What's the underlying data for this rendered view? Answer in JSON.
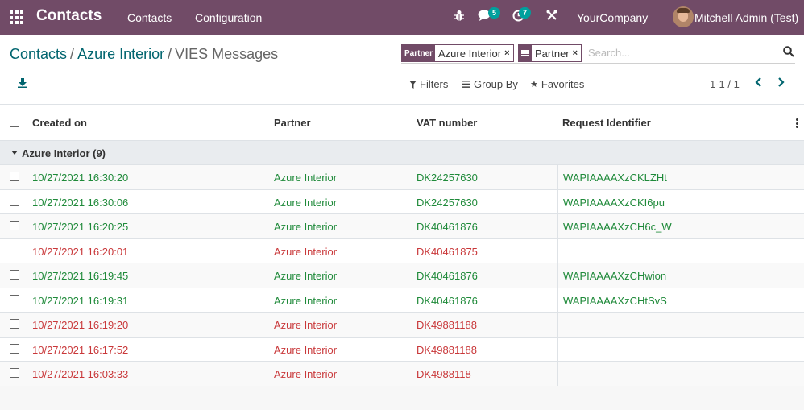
{
  "navbar": {
    "app_title": "Contacts",
    "menu": [
      "Contacts",
      "Configuration"
    ],
    "messages_count": "5",
    "activities_count": "7",
    "company": "YourCompany",
    "user": "Mitchell Admin (Test)"
  },
  "breadcrumb": {
    "items": [
      "Contacts",
      "Azure Interior"
    ],
    "current": "VIES Messages"
  },
  "search": {
    "facets": [
      {
        "head": "Partner",
        "value": "Azure Interior"
      },
      {
        "head_icon": "group-by-icon",
        "value": "Partner"
      }
    ],
    "placeholder": "Search..."
  },
  "toolbar": {
    "filters_label": "Filters",
    "group_by_label": "Group By",
    "favorites_label": "Favorites",
    "pager": "1-1 / 1"
  },
  "table": {
    "columns": [
      "Created on",
      "Partner",
      "VAT number",
      "Request Identifier"
    ],
    "group": {
      "label": "Azure Interior (9)"
    },
    "rows": [
      {
        "created": "10/27/2021 16:30:20",
        "partner": "Azure Interior",
        "vat": "DK24257630",
        "request": "WAPIAAAAXzCKLZHt",
        "status": "ok"
      },
      {
        "created": "10/27/2021 16:30:06",
        "partner": "Azure Interior",
        "vat": "DK24257630",
        "request": "WAPIAAAAXzCKI6pu",
        "status": "ok"
      },
      {
        "created": "10/27/2021 16:20:25",
        "partner": "Azure Interior",
        "vat": "DK40461876",
        "request": "WAPIAAAAXzCH6c_W",
        "status": "ok"
      },
      {
        "created": "10/27/2021 16:20:01",
        "partner": "Azure Interior",
        "vat": "DK40461875",
        "request": "",
        "status": "err"
      },
      {
        "created": "10/27/2021 16:19:45",
        "partner": "Azure Interior",
        "vat": "DK40461876",
        "request": "WAPIAAAAXzCHwion",
        "status": "ok"
      },
      {
        "created": "10/27/2021 16:19:31",
        "partner": "Azure Interior",
        "vat": "DK40461876",
        "request": "WAPIAAAAXzCHtSvS",
        "status": "ok"
      },
      {
        "created": "10/27/2021 16:19:20",
        "partner": "Azure Interior",
        "vat": "DK49881188",
        "request": "",
        "status": "err"
      },
      {
        "created": "10/27/2021 16:17:52",
        "partner": "Azure Interior",
        "vat": "DK49881188",
        "request": "",
        "status": "err"
      },
      {
        "created": "10/27/2021 16:03:33",
        "partner": "Azure Interior",
        "vat": "DK4988118",
        "request": "",
        "status": "err"
      }
    ]
  },
  "colors": {
    "brand": "#714b67",
    "link": "#01656f",
    "success": "#1f8a3a",
    "danger": "#c9383a",
    "badge": "#00a09d"
  }
}
